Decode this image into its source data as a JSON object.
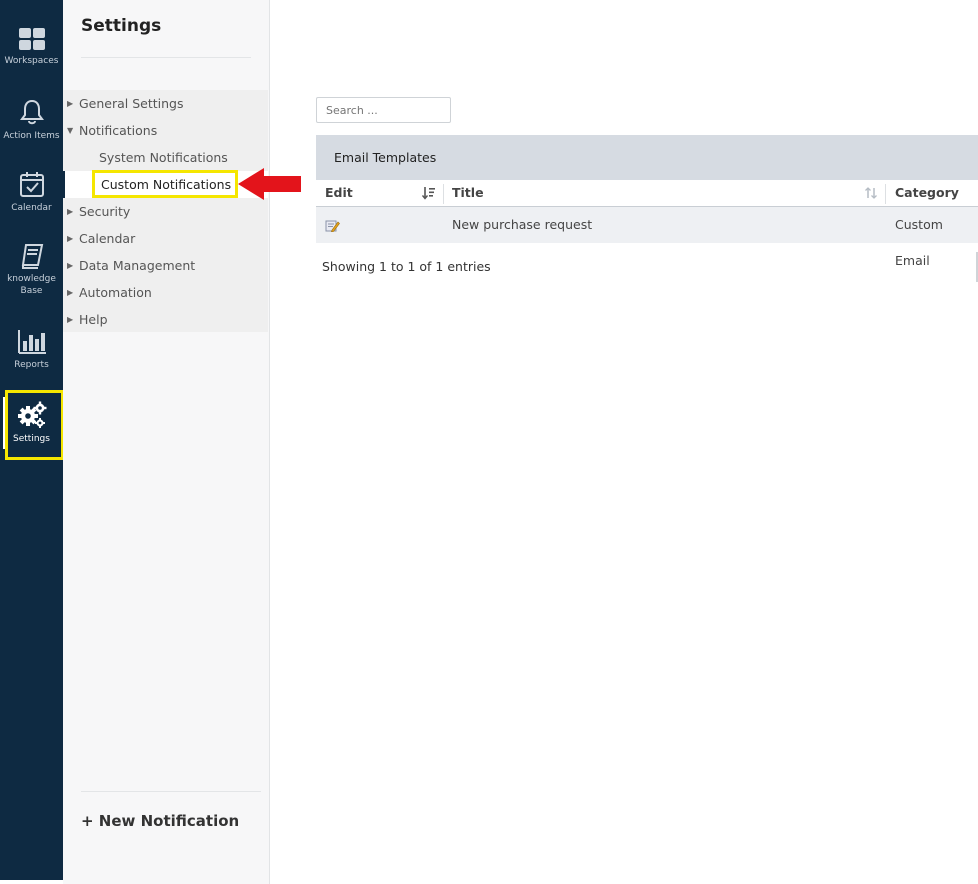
{
  "rail": {
    "items": [
      {
        "label": "Workspaces",
        "icon": "workspaces-icon"
      },
      {
        "label": "Action Items",
        "icon": "bell-icon"
      },
      {
        "label": "Calendar",
        "icon": "calendar-check-icon"
      },
      {
        "label_line1": "knowledge",
        "label_line2": "Base",
        "icon": "book-icon"
      },
      {
        "label": "Reports",
        "icon": "bar-chart-icon"
      },
      {
        "label": "Settings",
        "icon": "gears-icon"
      }
    ]
  },
  "nav": {
    "title": "Settings",
    "items": [
      {
        "label": "General Settings",
        "expanded": false
      },
      {
        "label": "Notifications",
        "expanded": true
      },
      {
        "label": "System Notifications"
      },
      {
        "label": "Custom Notifications",
        "selected": true
      },
      {
        "label": "Security",
        "expanded": false
      },
      {
        "label": "Calendar",
        "expanded": false
      },
      {
        "label": "Data Management",
        "expanded": false
      },
      {
        "label": "Automation",
        "expanded": false
      },
      {
        "label": "Help",
        "expanded": false
      }
    ],
    "new_button": "+ New Notification"
  },
  "main": {
    "search_placeholder": "Search ...",
    "table_title": "Email Templates",
    "columns": [
      "Edit",
      "Title",
      "Category"
    ],
    "rows": [
      {
        "title": "New purchase request",
        "category": "Custom Email"
      }
    ],
    "info": "Showing 1 to 1 of 1 entries"
  },
  "colors": {
    "rail_bg": "#0e2a42",
    "highlight": "#f5e600",
    "arrow": "#e3141b"
  }
}
